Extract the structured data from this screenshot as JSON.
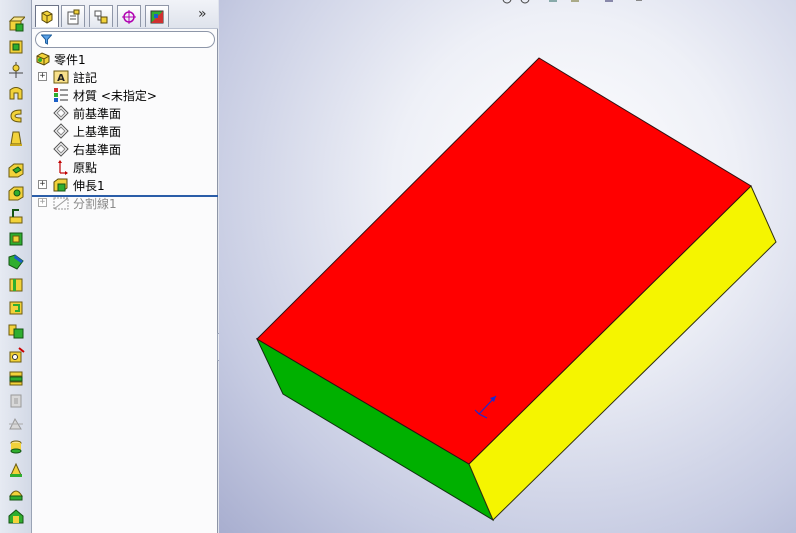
{
  "feature_tree": {
    "root_label": "零件1",
    "items": [
      {
        "label": "註記",
        "expandable": true,
        "icon": "annotations-icon",
        "dimmed": false
      },
      {
        "label": "材質 <未指定>",
        "expandable": false,
        "icon": "material-icon",
        "dimmed": false
      },
      {
        "label": "前基準面",
        "expandable": false,
        "icon": "plane-icon",
        "dimmed": false
      },
      {
        "label": "上基準面",
        "expandable": false,
        "icon": "plane-icon",
        "dimmed": false
      },
      {
        "label": "右基準面",
        "expandable": false,
        "icon": "plane-icon",
        "dimmed": false
      },
      {
        "label": "原點",
        "expandable": false,
        "icon": "origin-icon",
        "dimmed": false
      },
      {
        "label": "伸長1",
        "expandable": true,
        "icon": "extrude-icon",
        "dimmed": false
      },
      {
        "label": "分割線1",
        "expandable": true,
        "icon": "split-line-icon",
        "dimmed": true
      }
    ]
  },
  "tabs": [
    {
      "name": "feature-manager-tab",
      "icon": "feature-manager-icon",
      "active": true
    },
    {
      "name": "property-manager-tab",
      "icon": "property-manager-icon",
      "active": false
    },
    {
      "name": "configuration-manager-tab",
      "icon": "configuration-manager-icon",
      "active": false
    },
    {
      "name": "dimxpert-manager-tab",
      "icon": "dimxpert-icon",
      "active": false
    },
    {
      "name": "display-manager-tab",
      "icon": "display-manager-icon",
      "active": false
    }
  ],
  "expand_tabs_glyph": "»",
  "model": {
    "faces": {
      "top": "#ff0000",
      "right": "#f5f500",
      "front": "#00b000"
    }
  },
  "colors": {
    "toolbar_bg": "#dfe3ec",
    "rollback_bar": "#2a5da8"
  }
}
